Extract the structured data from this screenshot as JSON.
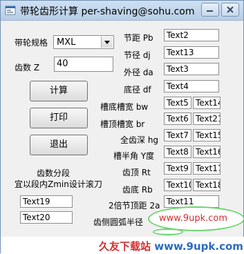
{
  "window": {
    "title": "带轮齿形计算 per-shaving@sohu.com"
  },
  "spec": {
    "label": "带轮规格",
    "selected": "MXL"
  },
  "teeth": {
    "label": "齿数 Z",
    "value": "40"
  },
  "buttons": {
    "calc": "计算",
    "print": "打印",
    "exit": "退出"
  },
  "segment": {
    "line1": "齿数分段",
    "line2": "宜以段内Zmin设计滚刀"
  },
  "left_fields": [
    "Text19",
    "Text20"
  ],
  "params": [
    {
      "label": "节距 Pb",
      "v1": "Text2"
    },
    {
      "label": "节径 dj",
      "v1": "Text13"
    },
    {
      "label": "外径 da",
      "v1": "Text3"
    },
    {
      "label": "底径 df",
      "v1": "Text4"
    },
    {
      "label": "槽底槽宽 bw",
      "v1": "Text5",
      "v2": "Text14"
    },
    {
      "label": "槽顶槽宽 br",
      "v1": "Text6",
      "v2": "Text21"
    },
    {
      "label": "全齿深 hg",
      "v1": "Text7",
      "v2": "Text15"
    },
    {
      "label": "槽半角 Y度",
      "v1": "Text8",
      "v2": "Text16"
    },
    {
      "label": "齿顶 Rt",
      "v1": "Text9",
      "v2": "Text17"
    },
    {
      "label": "齿底 Rb",
      "v1": "Text10",
      "v2": "Text18"
    },
    {
      "label": "2倍节顶距 2a",
      "v1": "Text11"
    },
    {
      "label": "齿侧圆弧半径"
    }
  ],
  "watermark": {
    "url": "www.9upk.com",
    "banner_brand": "久友下载站",
    "banner_url": "www.9upk.com"
  },
  "icons": {
    "app": "app-icon",
    "min": "minimize-icon",
    "close": "close-icon",
    "dropdown": "chevron-down-icon"
  }
}
